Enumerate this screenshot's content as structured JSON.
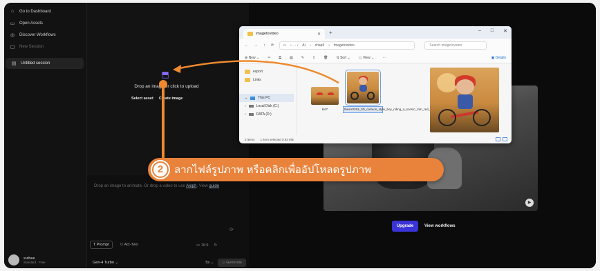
{
  "sidebar": {
    "items": [
      {
        "label": "Go to Dashboard",
        "icon": "dashboard-icon",
        "dim": false
      },
      {
        "label": "Open Assets",
        "icon": "folder-icon",
        "dim": false
      },
      {
        "label": "Discover Workflows",
        "icon": "discover-icon",
        "dim": false
      },
      {
        "label": "New Session",
        "icon": "new-session-icon",
        "dim": true
      }
    ],
    "active_session": "Untitled session",
    "user_name": "suthee",
    "user_plan": "Standard · Free"
  },
  "panel": {
    "drop_text": "Drop an image or click to upload",
    "select_asset": "Select asset",
    "create_image": "Create image",
    "hint_text": "Drop an image to animate. Or drop a video to use",
    "hint_link": "Aleph",
    "hint_after": "View",
    "hint_last": "guide",
    "prompt_btn": "Prompt",
    "act_two_btn": "Act-Two",
    "ratio": "16:9",
    "model": "Gen-4 Turbo",
    "duration": "5s",
    "generate": "Generate"
  },
  "right": {
    "upgrade": "Upgrade",
    "view_workflows": "View workflows"
  },
  "explorer": {
    "tab_title": "imagetovideo",
    "path": [
      "AI",
      "chap5",
      "imagetovideo"
    ],
    "search_placeholder": "Search imagetovideo",
    "toolbar": [
      "New",
      "Sort",
      "View",
      "Details"
    ],
    "nav": [
      "export",
      "Links",
      "This PC",
      "Local Disk (C:)",
      "DATA (D:)"
    ],
    "files": [
      {
        "name": "kid7"
      },
      {
        "name": "thesrr0253_3D_cartoon_style_boy_riding_a_scenic_mtn_red_bicycl..."
      }
    ],
    "status_items": "2 items",
    "status_selected": "1 item selected  0.93 MB"
  },
  "annotation": {
    "step": "2",
    "text": "ลากไฟล์รูปภาพ หรือคลิกเพื่ออัปโหลดรูปภาพ",
    "color": "#e9823a"
  }
}
